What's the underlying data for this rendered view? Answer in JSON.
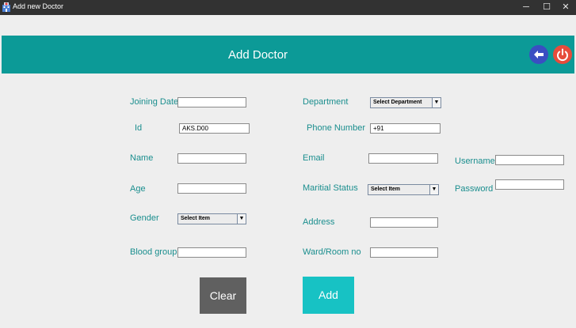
{
  "window": {
    "title": "Add new Doctor",
    "minimize": "─",
    "maximize": "☐",
    "close": "✕"
  },
  "header": {
    "title": "Add Doctor",
    "back_icon": "arrow-left-icon",
    "power_icon": "power-icon",
    "colors": {
      "bar": "#0c9a97",
      "back": "#3a4ec2",
      "power": "#e64c3c"
    }
  },
  "form": {
    "joining_date": {
      "label": "Joining Date",
      "value": ""
    },
    "id": {
      "label": "Id",
      "value": "AKS.D00"
    },
    "name": {
      "label": "Name",
      "value": ""
    },
    "age": {
      "label": "Age",
      "value": ""
    },
    "gender": {
      "label": "Gender",
      "selected": "Select Item"
    },
    "blood_group": {
      "label": "Blood group",
      "value": ""
    },
    "department": {
      "label": "Department",
      "selected": "Select Department"
    },
    "phone": {
      "label": "Phone Number",
      "value": "+91"
    },
    "email": {
      "label": "Email",
      "value": ""
    },
    "marital_status": {
      "label": "Maritial Status",
      "selected": "Select Item"
    },
    "address": {
      "label": "Address",
      "value": ""
    },
    "ward": {
      "label": "Ward/Room no",
      "value": ""
    },
    "username": {
      "label": "Username",
      "value": ""
    },
    "password": {
      "label": "Password",
      "value": ""
    }
  },
  "buttons": {
    "clear": "Clear",
    "add": "Add",
    "colors": {
      "clear": "#606060",
      "add": "#17c2c4"
    }
  }
}
